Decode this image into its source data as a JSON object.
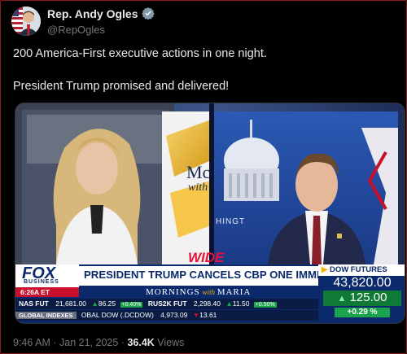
{
  "author": {
    "display_name": "Rep. Andy Ogles",
    "handle": "@RepOgles",
    "verified_icon": "verified-badge-icon"
  },
  "tweet": {
    "line1": "200 America-First executive actions in one night.",
    "line2": "President Trump promised and delivered!"
  },
  "video": {
    "network_logo_main": "FOX",
    "network_logo_sub": "BUSINESS",
    "clock": "6:26A ET",
    "headline": "PRESIDENT TRUMP CANCELS CBP ONE IMMIGRATION APP",
    "show_name_a": "MORNINGS",
    "show_name_b": "with",
    "show_name_c": "MARIA",
    "wide_label": "WIDE",
    "background_sign_left": "Mc",
    "background_sign_left2": "with",
    "background_sign_right": "HINGT",
    "ticker": {
      "nas_label": "NAS FUT",
      "nas_value": "21,681.00",
      "nas_change": "86.25",
      "nas_pct": "+0.40%",
      "rus_label": "RUS2K FUT",
      "rus_value": "2,298.40",
      "rus_change": "11.50",
      "rus_pct": "+0.50%",
      "global_label": "GLOBAL INDEXES",
      "global_text": "OBAL DOW (.DCDOW)",
      "global_value": "4,973.09",
      "global_change": "13.61"
    },
    "dow": {
      "label": "DOW FUTURES",
      "value": "43,820.00",
      "change": "125.00",
      "pct": "+0.29 %"
    },
    "colors": {
      "fox_blue": "#0b2a6b",
      "fox_red": "#c8102e",
      "green": "#1aa34a",
      "gold": "#f0b400"
    }
  },
  "meta": {
    "time": "9:46 AM",
    "sep1": "·",
    "date": "Jan 21, 2025",
    "sep2": "·",
    "views_count": "36.4K",
    "views_label": "Views"
  }
}
